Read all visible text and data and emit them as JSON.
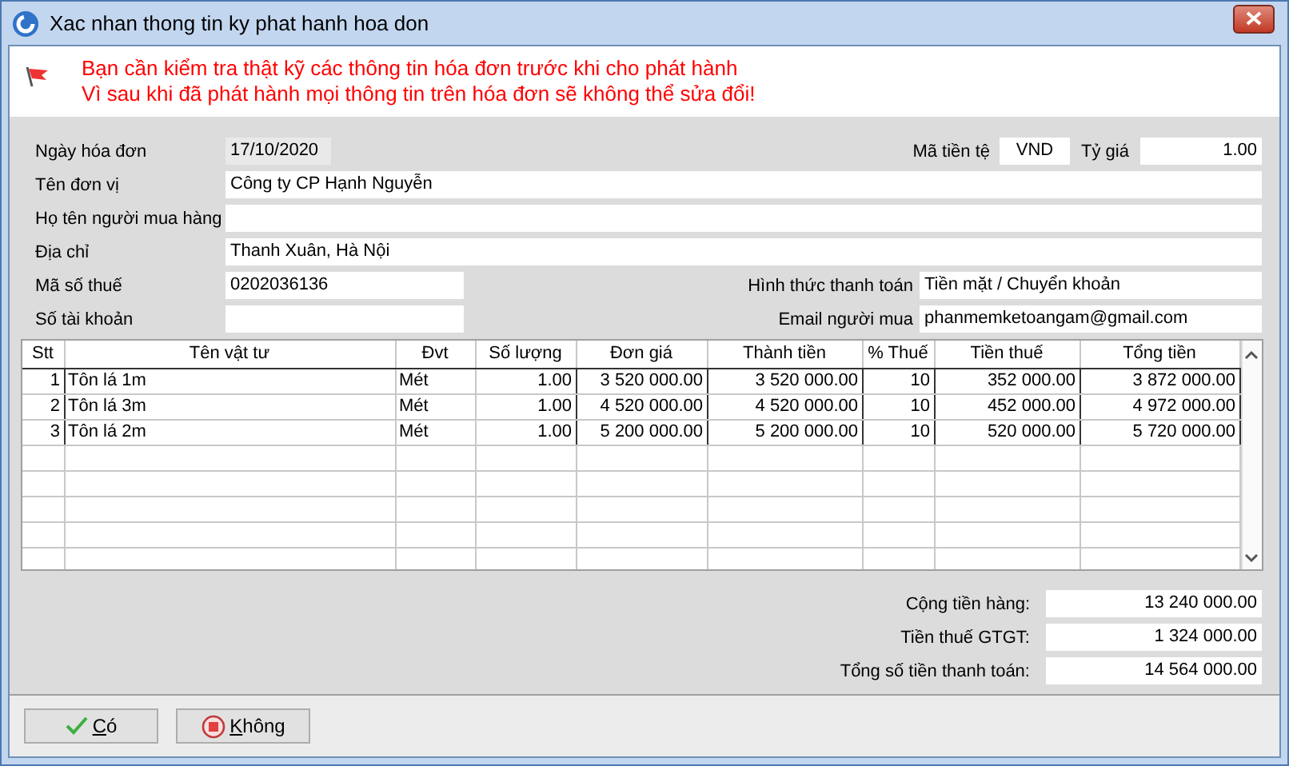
{
  "window": {
    "title": "Xac nhan thong tin ky phat hanh hoa don"
  },
  "warning": {
    "lines": [
      "Bạn cần kiểm tra thật kỹ các thông tin hóa đơn trước khi cho phát hành",
      "Vì sau khi đã phát hành mọi thông tin trên hóa đơn sẽ không thể sửa đổi!"
    ]
  },
  "form": {
    "invoice_date": {
      "label": "Ngày hóa đơn",
      "value": "17/10/2020",
      "disabled": true
    },
    "currency": {
      "label": "Mã tiền tệ",
      "value": "VND",
      "disabled": false
    },
    "exchange_rate": {
      "label": "Tỷ giá",
      "value": "1.00",
      "disabled": false
    },
    "unit_name": {
      "label": "Tên đơn vị",
      "value": "Công ty CP Hạnh Nguyễn",
      "disabled": false
    },
    "buyer_name": {
      "label": "Họ tên người mua hàng",
      "disabled": false
    },
    "address": {
      "label": "Địa chỉ",
      "value": "Thanh Xuân, Hà Nội",
      "disabled": false
    },
    "tax_code": {
      "label": "Mã số thuế",
      "value": "0202036136",
      "disabled": false
    },
    "payment_method": {
      "label": "Hình thức thanh toán",
      "value": "Tiền mặt / Chuyển khoản",
      "disabled": false
    },
    "account_number": {
      "label": "Số tài khoản",
      "disabled": false
    },
    "buyer_email": {
      "label": "Email người mua",
      "value": "phanmemketoangam@gmail.com",
      "disabled": false
    }
  },
  "table": {
    "columns": [
      "Stt",
      "Tên vật tư",
      "Đvt",
      "Số lượng",
      "Đơn giá",
      "Thành tiền",
      "% Thuế",
      "Tiền thuế",
      "Tổng tiền"
    ],
    "rows": [
      [
        "1",
        "Tôn lá 1m",
        "Mét",
        "1.00",
        "3 520 000.00",
        "3 520 000.00",
        "10",
        "352 000.00",
        "3 872 000.00"
      ],
      [
        "2",
        "Tôn lá 3m",
        "Mét",
        "1.00",
        "4 520 000.00",
        "4 520 000.00",
        "10",
        "452 000.00",
        "4 972 000.00"
      ],
      [
        "3",
        "Tôn lá 2m",
        "Mét",
        "1.00",
        "5 200 000.00",
        "5 200 000.00",
        "10",
        "520 000.00",
        "5 720 000.00"
      ]
    ]
  },
  "totals": [
    {
      "label": "Cộng tiền hàng:",
      "value": "13 240 000.00"
    },
    {
      "label": "Tiền thuế GTGT:",
      "value": "1 324 000.00"
    },
    {
      "label": "Tổng số tiền thanh toán:",
      "value": "14 564 000.00"
    }
  ],
  "buttons": [
    {
      "label": "Có",
      "kind": "ok"
    },
    {
      "label": "Không",
      "kind": "cancel"
    }
  ]
}
